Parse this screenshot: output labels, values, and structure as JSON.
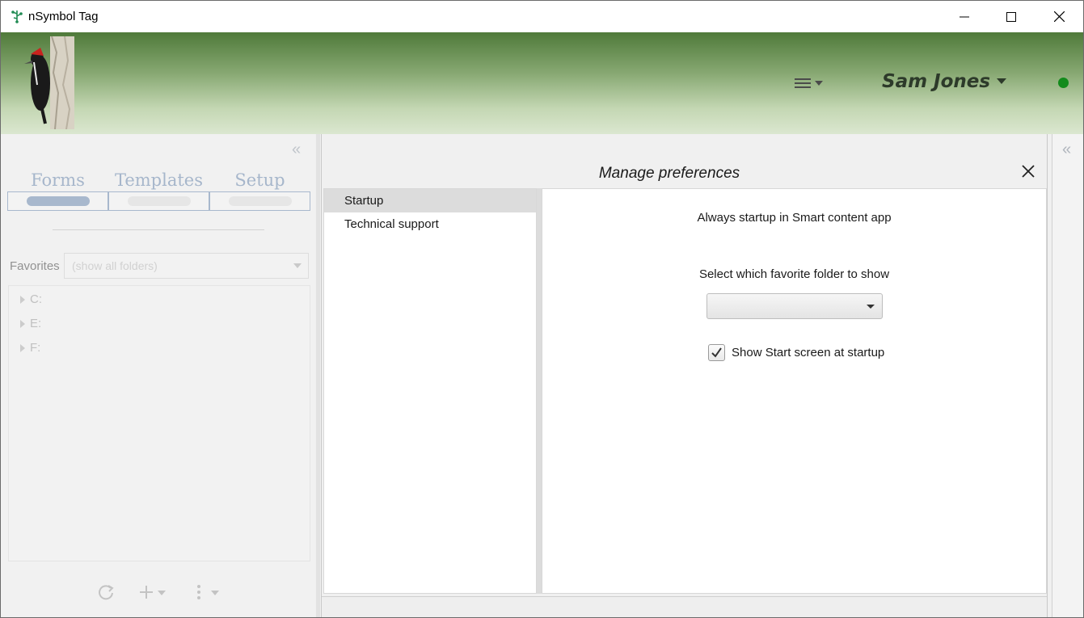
{
  "window": {
    "title": "nSymbol Tag",
    "controls": {
      "minimize": "minimize-icon",
      "maximize": "maximize-icon",
      "close": "close-icon"
    }
  },
  "banner": {
    "logo": "woodpecker-logo",
    "user_name": "Sam Jones",
    "status_color": "#138b1c"
  },
  "left_panel": {
    "collapse_glyph": "«",
    "tabs": [
      {
        "label": "Forms",
        "active": true
      },
      {
        "label": "Templates",
        "active": false
      },
      {
        "label": "Setup",
        "active": false
      }
    ],
    "favorites_label": "Favorites",
    "favorites_placeholder": "(show all folders)",
    "tree": [
      {
        "label": "C:"
      },
      {
        "label": "E:"
      },
      {
        "label": "F:"
      }
    ],
    "bottom_icons": [
      "refresh-icon",
      "add-icon",
      "more-icon"
    ]
  },
  "dialog": {
    "title": "Manage preferences",
    "categories": [
      {
        "label": "Startup",
        "selected": true
      },
      {
        "label": "Technical support",
        "selected": false
      }
    ],
    "startup": {
      "always_startup_text": "Always startup in Smart content app",
      "favorite_folder_label": "Select which favorite folder to show",
      "favorite_folder_value": "",
      "show_start_screen_label": "Show Start screen at startup",
      "show_start_screen_checked": true
    }
  },
  "right_panel": {
    "collapse_glyph": "«"
  }
}
